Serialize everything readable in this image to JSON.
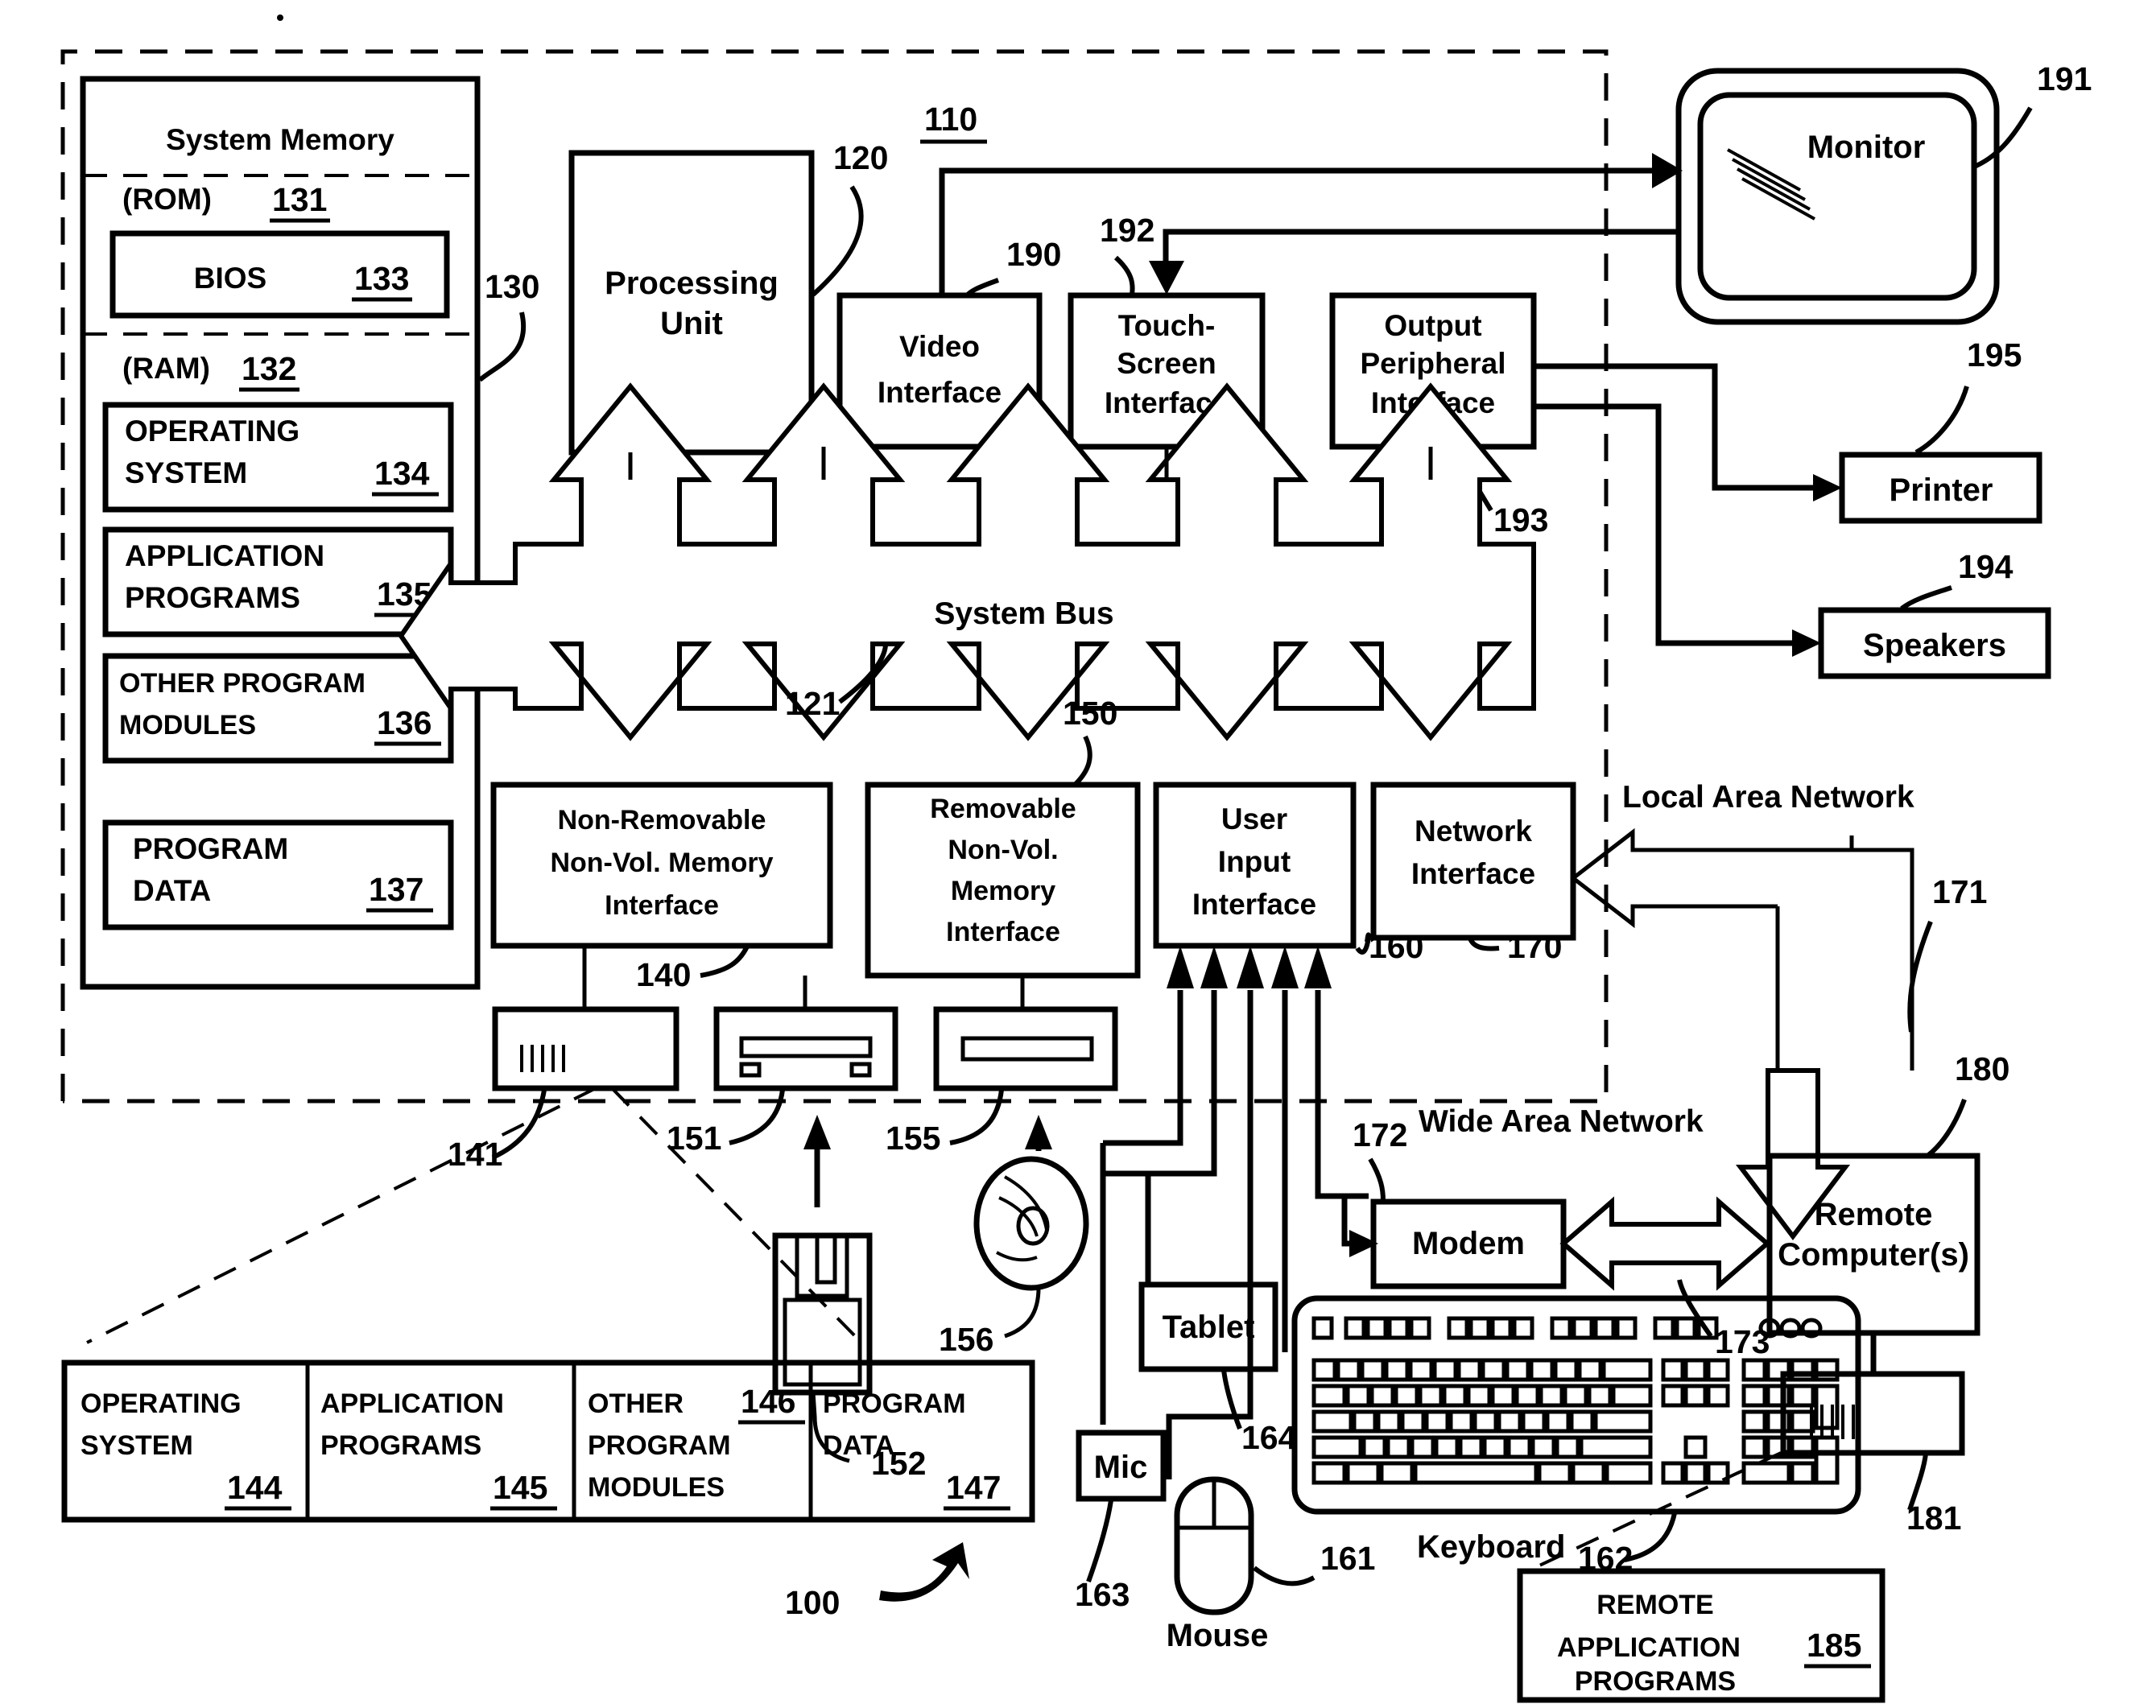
{
  "figure": {
    "overall_ref": "100",
    "computer_ref": "110"
  },
  "system_memory": {
    "title": "System Memory",
    "rom_label": "(ROM)",
    "rom_ref": "131",
    "bios_label": "BIOS",
    "bios_ref": "133",
    "ram_label": "(RAM)",
    "ram_ref": "132",
    "memory_ref": "130",
    "blocks": [
      {
        "line1": "OPERATING",
        "line2": "SYSTEM",
        "ref": "134"
      },
      {
        "line1": "APPLICATION",
        "line2": "PROGRAMS",
        "ref": "135"
      },
      {
        "line1": "OTHER PROGRAM",
        "line2": "MODULES",
        "ref": "136"
      },
      {
        "line1": "PROGRAM",
        "line2": "DATA",
        "ref": "137"
      }
    ]
  },
  "processing_unit": {
    "label_line1": "Processing",
    "label_line2": "Unit",
    "ref": "120"
  },
  "interfaces_top": [
    {
      "line1": "Video",
      "line2": "Interface",
      "line3": "",
      "ref": "190"
    },
    {
      "line1": "Touch-",
      "line2": "Screen",
      "line3": "Interface",
      "ref": "192"
    },
    {
      "line1": "Output",
      "line2": "Peripheral",
      "line3": "Interface",
      "ref": "193"
    }
  ],
  "system_bus": {
    "label": "System Bus",
    "ref": "121"
  },
  "interfaces_bottom": [
    {
      "line1": "Non-Removable",
      "line2": "Non-Vol. Memory",
      "line3": "Interface",
      "ref": "140"
    },
    {
      "line1": "Removable",
      "line2": "Non-Vol.",
      "line3": "Memory",
      "line4": "Interface",
      "ref": "150"
    },
    {
      "line1": "User",
      "line2": "Input",
      "line3": "Interface",
      "ref": "160"
    },
    {
      "line1": "Network",
      "line2": "Interface",
      "line3": "",
      "ref": "170"
    }
  ],
  "output_devices": {
    "monitor": {
      "label": "Monitor",
      "ref": "191"
    },
    "printer": {
      "label": "Printer",
      "ref": "195"
    },
    "speakers": {
      "label": "Speakers",
      "ref": "194"
    }
  },
  "drives": {
    "hard_disk_ref": "141",
    "floppy_drive_ref": "151",
    "floppy_disk_ref": "152",
    "optical_drive_ref": "155",
    "optical_disc_ref": "156"
  },
  "expanded_storage": [
    {
      "line1": "OPERATING",
      "line2": "SYSTEM",
      "ref": "144",
      "ref_pos": "bottom"
    },
    {
      "line1": "APPLICATION",
      "line2": "PROGRAMS",
      "ref": "145",
      "ref_pos": "bottom"
    },
    {
      "line1": "OTHER",
      "line2": "PROGRAM",
      "line3": "MODULES",
      "ref": "146",
      "ref_pos": "top"
    },
    {
      "line1": "PROGRAM",
      "line2": "DATA",
      "ref": "147",
      "ref_pos": "bottom"
    }
  ],
  "input_devices": {
    "tablet": {
      "label": "Tablet",
      "ref": "164"
    },
    "mic": {
      "label": "Mic",
      "ref": "163"
    },
    "mouse": {
      "label": "Mouse",
      "ref": "161"
    },
    "keyboard": {
      "label": "Keyboard",
      "ref": "162"
    }
  },
  "networking": {
    "lan_label": "Local Area Network",
    "lan_ref": "171",
    "wan_label": "Wide Area Network",
    "wan_ref": "173",
    "modem": {
      "label": "Modem",
      "ref": "172"
    },
    "remote_computer": {
      "line1": "Remote",
      "line2": "Computer(s)",
      "ref": "180"
    },
    "remote_storage_ref": "181",
    "remote_apps": {
      "line1": "REMOTE",
      "line2": "APPLICATION",
      "line3": "PROGRAMS",
      "ref": "185"
    }
  }
}
